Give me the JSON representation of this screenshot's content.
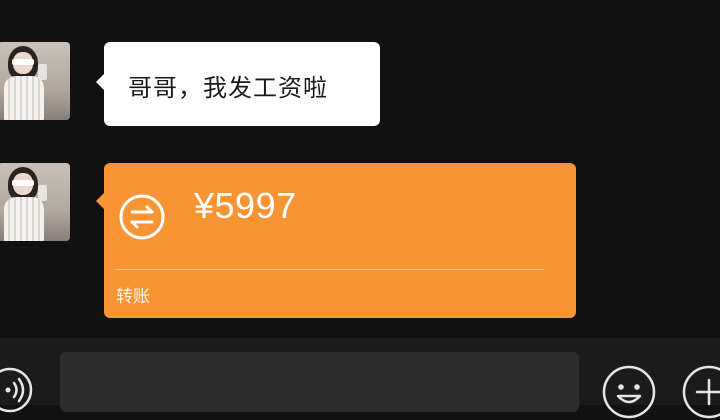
{
  "messages": [
    {
      "type": "text",
      "sender": "other",
      "text": "哥哥，我发工资啦"
    },
    {
      "type": "transfer",
      "sender": "other",
      "amount": "¥5997",
      "label": "转账"
    }
  ],
  "input_bar": {
    "value": "",
    "voice_icon": "voice-icon",
    "emoji_icon": "emoji-icon",
    "plus_icon": "plus-icon"
  },
  "colors": {
    "background": "#111111",
    "text_bubble": "#ffffff",
    "transfer_bubble": "#f79433",
    "input_bar": "#1b1b1b",
    "input_field": "#2c2c2c"
  }
}
